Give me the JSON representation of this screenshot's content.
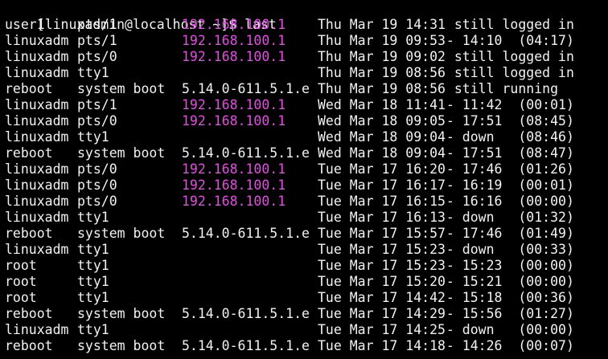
{
  "terminal": {
    "prompt": {
      "open_bracket": "[",
      "user": "linuxadmin",
      "at": "@",
      "host": "localhost",
      "path": " ~",
      "close": "]$ ",
      "command": "last"
    },
    "colors": {
      "background": "#000000",
      "text": "#f2f2f2",
      "ip_highlight": "#e84be8"
    },
    "rows": [
      {
        "user": "user1",
        "tty": "pts/1",
        "host": "192.168.100.1",
        "date": "Thu Mar 19 14:31",
        "period": "  still logged in"
      },
      {
        "user": "linuxadm",
        "tty": "pts/1",
        "host": "192.168.100.1",
        "date": "Thu Mar 19 09:53",
        "period": " - 14:10  (04:17)"
      },
      {
        "user": "linuxadm",
        "tty": "pts/0",
        "host": "192.168.100.1",
        "date": "Thu Mar 19 09:02",
        "period": "  still logged in"
      },
      {
        "user": "linuxadm",
        "tty": "tty1",
        "host": "",
        "date": "Thu Mar 19 08:56",
        "period": "  still logged in"
      },
      {
        "user": "reboot",
        "tty": "system boot",
        "host": "5.14.0-611.5.1.e",
        "date": "Thu Mar 19 08:56",
        "period": "  still running"
      },
      {
        "user": "linuxadm",
        "tty": "pts/1",
        "host": "192.168.100.1",
        "date": "Wed Mar 18 11:41",
        "period": " - 11:42  (00:01)"
      },
      {
        "user": "linuxadm",
        "tty": "pts/0",
        "host": "192.168.100.1",
        "date": "Wed Mar 18 09:05",
        "period": " - 17:51  (08:45)"
      },
      {
        "user": "linuxadm",
        "tty": "tty1",
        "host": "",
        "date": "Wed Mar 18 09:04",
        "period": " - down   (08:46)"
      },
      {
        "user": "reboot",
        "tty": "system boot",
        "host": "5.14.0-611.5.1.e",
        "date": "Wed Mar 18 09:04",
        "period": " - 17:51  (08:47)"
      },
      {
        "user": "linuxadm",
        "tty": "pts/0",
        "host": "192.168.100.1",
        "date": "Tue Mar 17 16:20",
        "period": " - 17:46  (01:26)"
      },
      {
        "user": "linuxadm",
        "tty": "pts/0",
        "host": "192.168.100.1",
        "date": "Tue Mar 17 16:17",
        "period": " - 16:19  (00:01)"
      },
      {
        "user": "linuxadm",
        "tty": "pts/0",
        "host": "192.168.100.1",
        "date": "Tue Mar 17 16:15",
        "period": " - 16:16  (00:00)"
      },
      {
        "user": "linuxadm",
        "tty": "tty1",
        "host": "",
        "date": "Tue Mar 17 16:13",
        "period": " - down   (01:32)"
      },
      {
        "user": "reboot",
        "tty": "system boot",
        "host": "5.14.0-611.5.1.e",
        "date": "Tue Mar 17 15:57",
        "period": " - 17:46  (01:49)"
      },
      {
        "user": "linuxadm",
        "tty": "tty1",
        "host": "",
        "date": "Tue Mar 17 15:23",
        "period": " - down   (00:33)"
      },
      {
        "user": "root",
        "tty": "tty1",
        "host": "",
        "date": "Tue Mar 17 15:23",
        "period": " - 15:23  (00:00)"
      },
      {
        "user": "root",
        "tty": "tty1",
        "host": "",
        "date": "Tue Mar 17 15:20",
        "period": " - 15:21  (00:00)"
      },
      {
        "user": "root",
        "tty": "tty1",
        "host": "",
        "date": "Tue Mar 17 14:42",
        "period": " - 15:18  (00:36)"
      },
      {
        "user": "reboot",
        "tty": "system boot",
        "host": "5.14.0-611.5.1.e",
        "date": "Tue Mar 17 14:29",
        "period": " - 15:56  (01:27)"
      },
      {
        "user": "linuxadm",
        "tty": "tty1",
        "host": "",
        "date": "Tue Mar 17 14:25",
        "period": " - down   (00:00)"
      },
      {
        "user": "reboot",
        "tty": "system boot",
        "host": "5.14.0-611.5.1.e",
        "date": "Tue Mar 17 14:18",
        "period": " - 14:26  (00:07)"
      }
    ]
  }
}
